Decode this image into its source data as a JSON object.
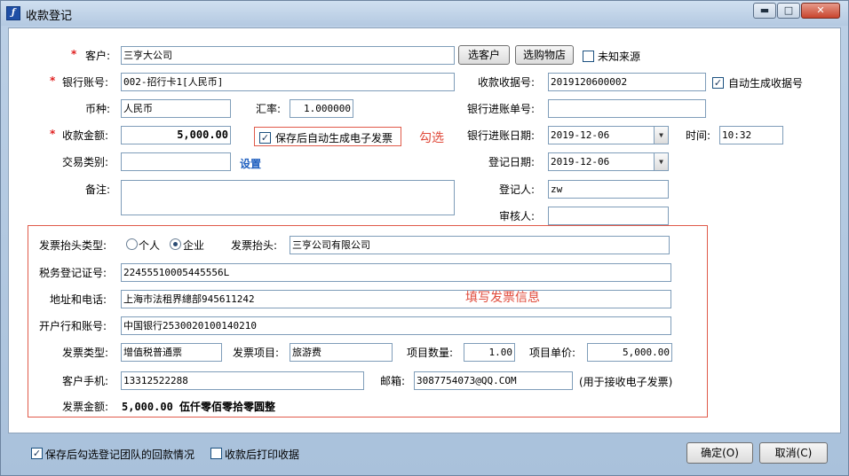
{
  "window": {
    "title": "收款登记",
    "minimize": "▬",
    "maximize": "□",
    "close": "✕"
  },
  "form": {
    "customer": {
      "label": "客户:",
      "value": "三亨大公司",
      "select_btn": "选客户",
      "select_shop_btn": "选购物店",
      "unknown_source": "未知来源"
    },
    "bank_account": {
      "label": "银行账号:",
      "value": "002-招行卡1[人民币]"
    },
    "receipt_no": {
      "label": "收款收据号:",
      "value": "2019120600002",
      "auto_label": "自动生成收据号"
    },
    "currency": {
      "label": "币种:",
      "value": "人民币"
    },
    "rate": {
      "label": "汇率:",
      "value": "1.000000"
    },
    "bank_in_no": {
      "label": "银行进账单号:",
      "value": ""
    },
    "amount": {
      "label": "收款金额:",
      "value": "5,000.00"
    },
    "auto_einvoice": "保存后自动生成电子发票",
    "annotation_check": "勾选",
    "bank_in_date": {
      "label": "银行进账日期:",
      "value": "2019-12-06"
    },
    "time": {
      "label": "时间:",
      "value": "10:32"
    },
    "trade_type": {
      "label": "交易类别:",
      "value": "",
      "setting": "设置"
    },
    "register_date": {
      "label": "登记日期:",
      "value": "2019-12-06"
    },
    "remark": {
      "label": "备注:",
      "value": ""
    },
    "registrar": {
      "label": "登记人:",
      "value": "zw"
    },
    "reviewer": {
      "label": "审核人:",
      "value": ""
    }
  },
  "invoice": {
    "header_type_label": "发票抬头类型:",
    "opt_personal": "个人",
    "opt_company": "企业",
    "header_label": "发票抬头:",
    "header_value": "三亨公司有限公司",
    "tax_no_label": "税务登记证号:",
    "tax_no_value": "22455510005445556L",
    "addr_label": "地址和电话:",
    "addr_value": "上海市法租界總部945611242",
    "bank_label": "开户行和账号:",
    "bank_value": "中国银行2530020100140210",
    "annotation_fill": "填写发票信息",
    "type_label": "发票类型:",
    "type_value": "增值税普通票",
    "item_label": "发票项目:",
    "item_value": "旅游费",
    "qty_label": "项目数量:",
    "qty_value": "1.00",
    "price_label": "项目单价:",
    "price_value": "5,000.00",
    "phone_label": "客户手机:",
    "phone_value": "13312522288",
    "email_label": "邮箱:",
    "email_value": "308775407З@QQ.COM",
    "email_hint": "(用于接收电子发票)",
    "amount_label": "发票金额:",
    "amount_value": "5,000.00  伍仟零佰零拾零圆整"
  },
  "footer": {
    "check_team_label": "保存后勾选登记团队的回款情况",
    "print_receipt_label": "收款后打印收据",
    "ok": "确定(O)",
    "cancel": "取消(C)"
  }
}
